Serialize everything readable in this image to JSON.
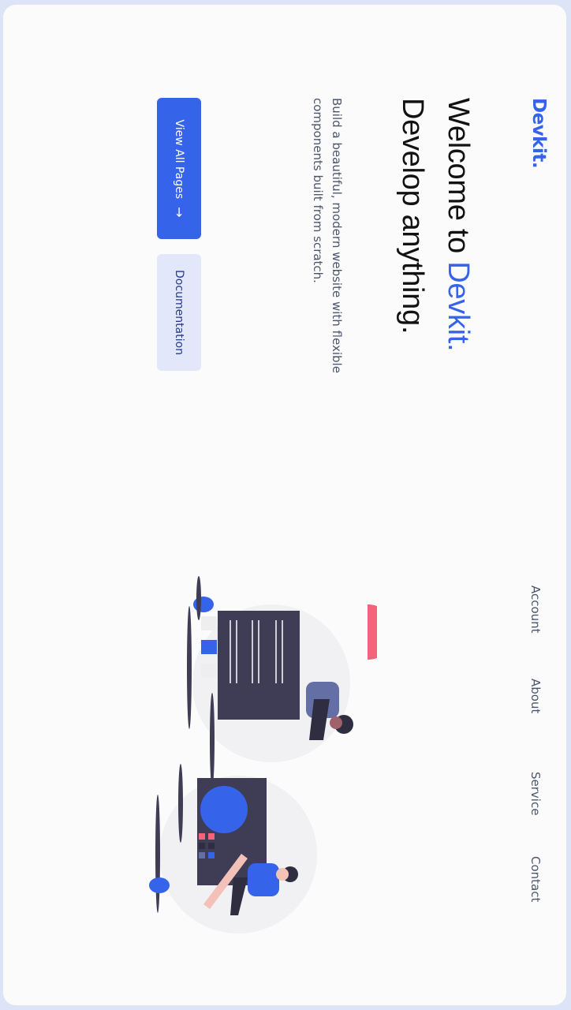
{
  "brand": {
    "logo": "Devkit."
  },
  "nav": {
    "items": [
      "Account",
      "About",
      "Service",
      "Contact"
    ]
  },
  "hero": {
    "title_prefix": "Welcome to ",
    "title_accent": "Devkit.",
    "title_line2": "Develop anything.",
    "subtitle": "Build a beautiful, modern website with flexible components built from scratch."
  },
  "buttons": {
    "primary_label": "View All Pages",
    "secondary_label": "Documentation"
  },
  "colors": {
    "accent": "#3563e9",
    "text_dark": "#121212",
    "text_muted": "#4b556c",
    "secondary_bg": "#e3e7fa",
    "illustration_dark": "#3f3d56",
    "illustration_pink": "#f5637a"
  },
  "icons": {
    "primary_button": "arrow-right-icon"
  }
}
